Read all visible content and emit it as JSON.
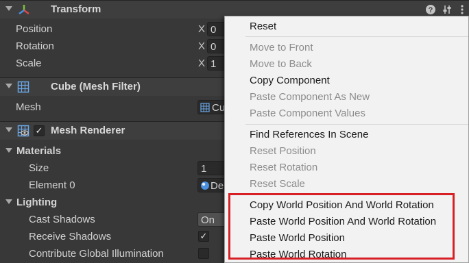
{
  "inspector": {
    "transform": {
      "title": "Transform",
      "position_label": "Position",
      "position_axis": "X",
      "position_x": "0",
      "rotation_label": "Rotation",
      "rotation_axis": "X",
      "rotation_x": "0",
      "scale_label": "Scale",
      "scale_axis": "X",
      "scale_x": "1"
    },
    "mesh_filter": {
      "title": "Cube (Mesh Filter)",
      "mesh_label": "Mesh",
      "mesh_value": "Cu"
    },
    "mesh_renderer": {
      "title": "Mesh Renderer",
      "enabled_check": "✓",
      "materials_label": "Materials",
      "size_label": "Size",
      "size_value": "1",
      "element0_label": "Element 0",
      "element0_value": "De",
      "lighting_label": "Lighting",
      "cast_shadows_label": "Cast Shadows",
      "cast_shadows_value": "On",
      "receive_shadows_label": "Receive Shadows",
      "receive_shadows_check": "✓",
      "contribute_gi_label": "Contribute Global Illumination"
    },
    "header_icons": [
      "help-icon",
      "preset-icon",
      "more-icon"
    ]
  },
  "context_menu": {
    "items": [
      {
        "label": "Reset",
        "enabled": true
      },
      {
        "label": "Move to Front",
        "enabled": false
      },
      {
        "label": "Move to Back",
        "enabled": false
      },
      {
        "label": "Copy Component",
        "enabled": true
      },
      {
        "label": "Paste Component As New",
        "enabled": false
      },
      {
        "label": "Paste Component Values",
        "enabled": false
      },
      {
        "label": "Find References In Scene",
        "enabled": true
      },
      {
        "label": "Reset Position",
        "enabled": false
      },
      {
        "label": "Reset Rotation",
        "enabled": false
      },
      {
        "label": "Reset Scale",
        "enabled": false
      },
      {
        "label": "Copy World Position And World Rotation",
        "enabled": true
      },
      {
        "label": "Paste World Position And World Rotation",
        "enabled": true
      },
      {
        "label": "Paste World Position",
        "enabled": true
      },
      {
        "label": "Paste World Rotation",
        "enabled": true
      }
    ]
  },
  "colors": {
    "highlight_box": "#d71f26",
    "menu_bg": "#f2f2f2",
    "inspector_bg": "#383838"
  }
}
